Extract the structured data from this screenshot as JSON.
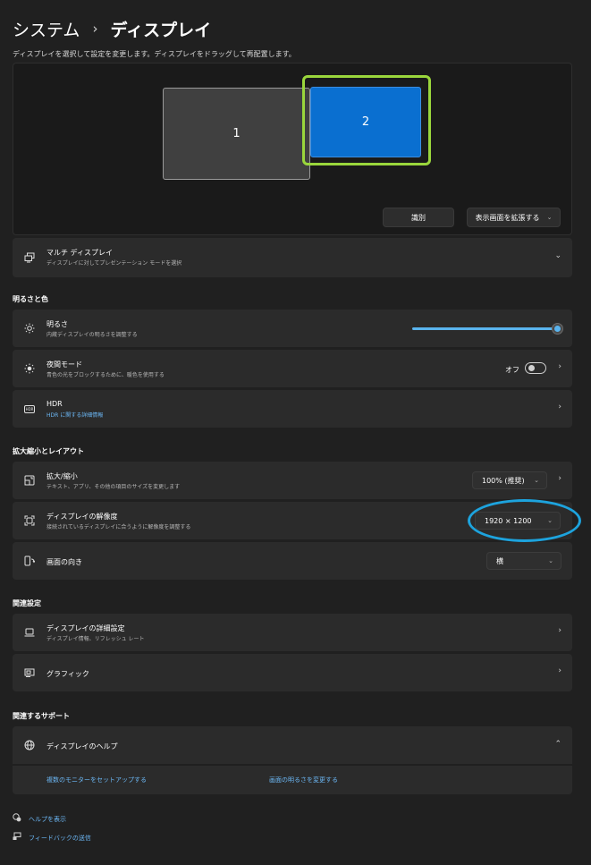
{
  "header": {
    "parent": "システム",
    "separator": "›",
    "current": "ディスプレイ",
    "instruction": "ディスプレイを選択して設定を変更します。ディスプレイをドラッグして再配置します。"
  },
  "arrangement": {
    "monitor_1": "1",
    "monitor_2": "2",
    "selected_monitor": "2",
    "identify_label": "識別",
    "extend_label": "表示画面を拡張する",
    "extend_caret": "⌄"
  },
  "multi_display": {
    "icon": "multi-display-icon",
    "title": "マルチ ディスプレイ",
    "subtitle": "ディスプレイに対してプレゼンテーション モードを選択",
    "chevron": "⌄"
  },
  "brightness_color": {
    "heading": "明るさと色",
    "brightness": {
      "icon": "sun-icon",
      "title": "明るさ",
      "subtitle": "内蔵ディスプレイの明るさを調整する",
      "level": 1.0
    },
    "night_mode": {
      "icon": "night-light-icon",
      "title": "夜間モード",
      "subtitle": "青色の光をブロックするために、暖色を使用する",
      "toggle_label": "オフ",
      "toggle_on": false,
      "chevron": "›"
    },
    "hdr": {
      "icon": "hdr-icon",
      "icon_text": "HDR",
      "title": "HDR",
      "link": "HDR に関する詳細情報",
      "chevron": "›"
    }
  },
  "scale_layout": {
    "heading": "拡大縮小とレイアウト",
    "scale": {
      "icon": "scale-icon",
      "title": "拡大/縮小",
      "subtitle": "テキスト、アプリ、その他の項目のサイズを変更します",
      "value": "100% (推奨)",
      "caret": "⌄",
      "chevron": "›"
    },
    "resolution": {
      "icon": "resolution-icon",
      "title": "ディスプレイの解像度",
      "subtitle": "接続されているディスプレイに合うように解像度を調整する",
      "value": "1920 × 1200",
      "caret": "⌄"
    },
    "orientation": {
      "icon": "orientation-icon",
      "title": "画面の向き",
      "value": "横",
      "caret": "⌄"
    }
  },
  "related": {
    "heading": "関連設定",
    "advanced": {
      "icon": "laptop-icon",
      "title": "ディスプレイの詳細設定",
      "subtitle": "ディスプレイ情報、リフレッシュ レート",
      "chevron": "›"
    },
    "graphics": {
      "icon": "graphics-card-icon",
      "title": "グラフィック",
      "chevron": "›"
    }
  },
  "support": {
    "heading": "関連するサポート",
    "help": {
      "icon": "globe-icon",
      "title": "ディスプレイのヘルプ",
      "chevron": "⌃"
    },
    "links": [
      "複数のモニターをセットアップする",
      "画面の明るさを変更する"
    ]
  },
  "footer": {
    "help_icon": "help-icon",
    "help": "ヘルプを表示",
    "feedback_icon": "feedback-icon",
    "feedback": "フィードバックの送信"
  },
  "colors": {
    "background": "#202020",
    "card": "#2b2b2b",
    "accent": "#0a6fd0",
    "link": "#6cb8f6",
    "selection_highlight": "#9ad63c",
    "annotation_ellipse": "#1da3dd"
  }
}
